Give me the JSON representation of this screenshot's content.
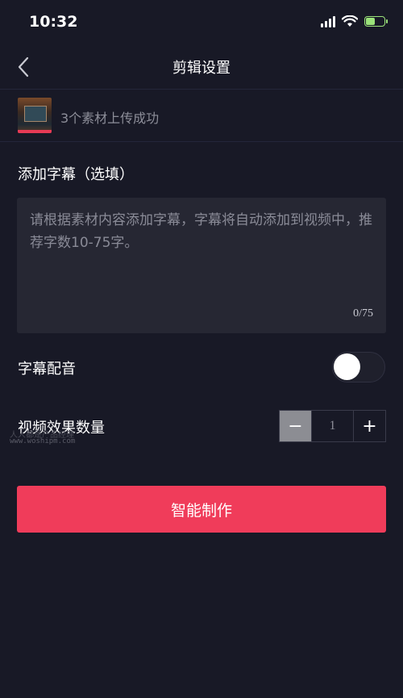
{
  "status_bar": {
    "time": "10:32"
  },
  "nav": {
    "title": "剪辑设置",
    "back_icon": "chevron-left-icon"
  },
  "upload": {
    "text": "3个素材上传成功"
  },
  "caption": {
    "title": "添加字幕（选填）",
    "value": "",
    "placeholder": "请根据素材内容添加字幕，字幕将自动添加到视频中，推荐字数10-75字。",
    "counter": "0/75"
  },
  "voiceover": {
    "label": "字幕配音",
    "enabled": false
  },
  "effects": {
    "label": "视频效果数量",
    "value": "1",
    "minus": "−",
    "plus": "+"
  },
  "watermark": {
    "line1": "人人都是产品经理",
    "line2": "www.woshipm.com"
  },
  "actions": {
    "primary": "智能制作"
  },
  "colors": {
    "accent": "#f03c5a",
    "background": "#181926",
    "panel": "#262733"
  }
}
